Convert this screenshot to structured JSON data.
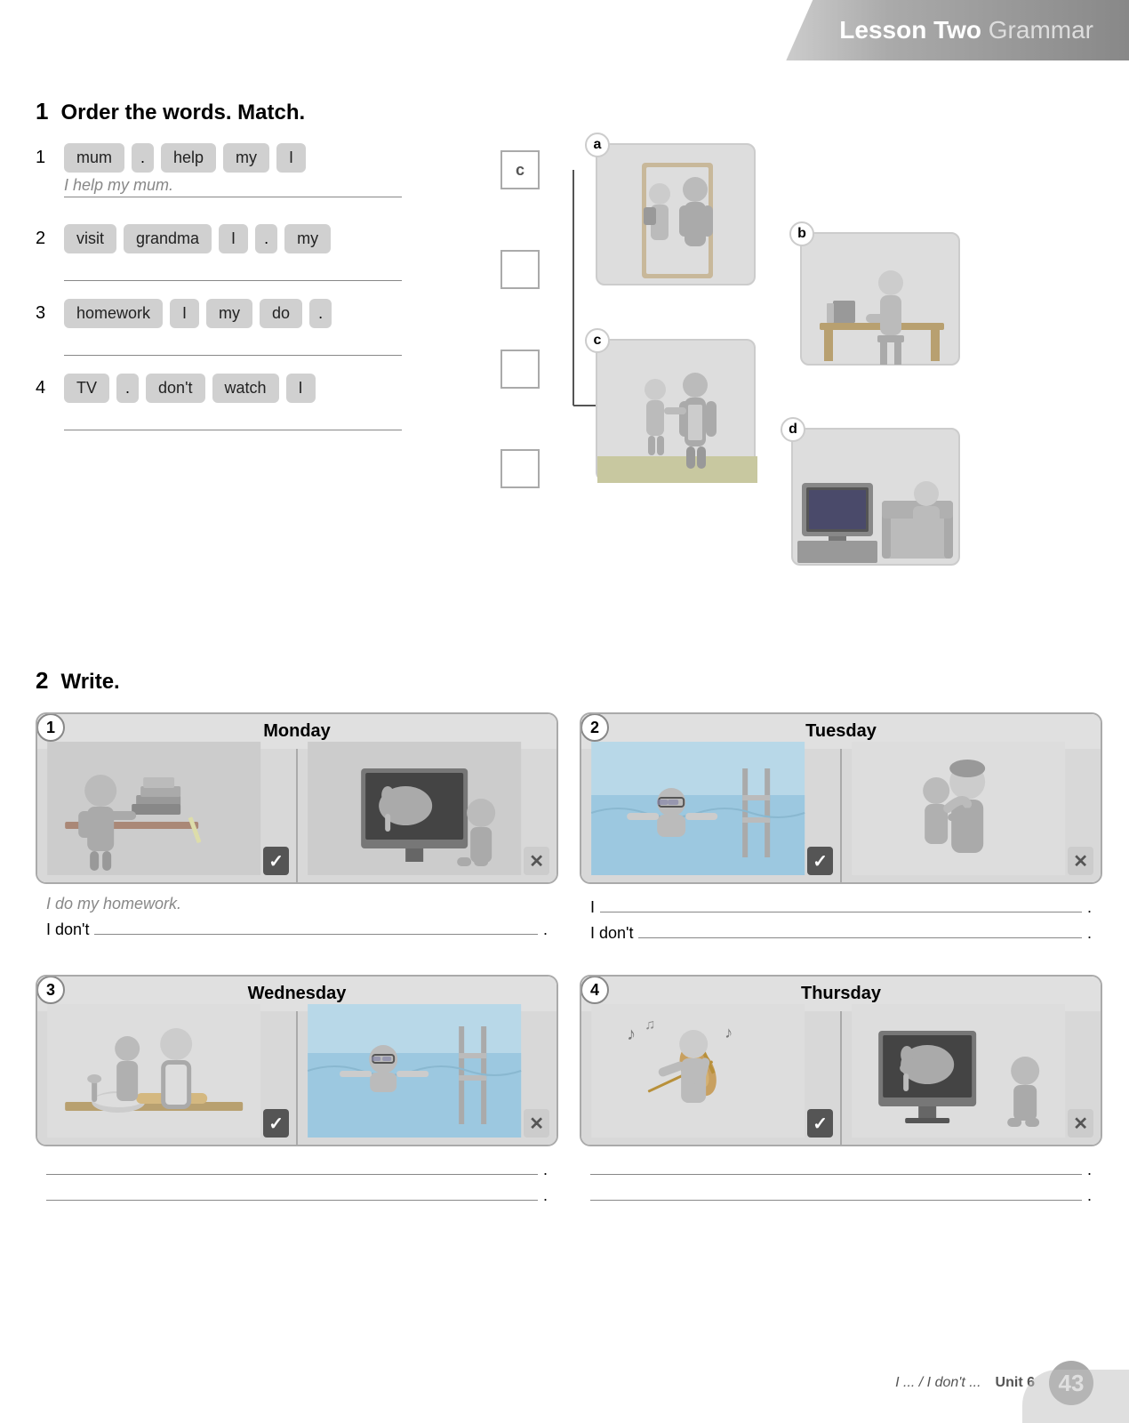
{
  "header": {
    "lesson_bold": "Lesson Two",
    "lesson_light": "Grammar"
  },
  "section1": {
    "number": "1",
    "heading": "Order the words. Match.",
    "rows": [
      {
        "num": "1",
        "chips": [
          "mum",
          ".",
          "help",
          "my",
          "I"
        ],
        "answer": "I help my mum.",
        "match_letter": "c"
      },
      {
        "num": "2",
        "chips": [
          "visit",
          "grandma",
          "I",
          ".",
          "my"
        ],
        "answer": "",
        "match_letter": ""
      },
      {
        "num": "3",
        "chips": [
          "homework",
          "I",
          "my",
          "do",
          "."
        ],
        "answer": "",
        "match_letter": ""
      },
      {
        "num": "4",
        "chips": [
          "TV",
          ".",
          "don't",
          "watch",
          "I"
        ],
        "answer": "",
        "match_letter": ""
      }
    ],
    "images": [
      {
        "label": "a",
        "description": "child helping at door with grandparent"
      },
      {
        "label": "b",
        "description": "child reading/studying at desk"
      },
      {
        "label": "c",
        "description": "child walking with adult outside"
      },
      {
        "label": "d",
        "description": "person watching TV on sofa"
      }
    ]
  },
  "section2": {
    "number": "2",
    "heading": "Write.",
    "cards": [
      {
        "number": "1",
        "day": "Monday",
        "img1_desc": "child doing homework at desk with books",
        "img2_desc": "child watching TV with elephant on screen",
        "img1_check": "check",
        "img2_check": "cross",
        "line1_prefix": "",
        "line1_text": "I do my homework.",
        "line1_italic": true,
        "line2_prefix": "I don't",
        "line2_blank": true
      },
      {
        "number": "2",
        "day": "Tuesday",
        "img1_desc": "child swimming in pool",
        "img2_desc": "child hugging grandparent",
        "img1_check": "check",
        "img2_check": "cross",
        "line1_prefix": "I",
        "line1_blank": true,
        "line2_prefix": "I don't",
        "line2_blank": true
      },
      {
        "number": "3",
        "day": "Wednesday",
        "img1_desc": "child cooking/baking with adult",
        "img2_desc": "child swimming with goggles",
        "img1_check": "check",
        "img2_check": "cross",
        "line1_blank_full": true,
        "line2_blank_full": true
      },
      {
        "number": "4",
        "day": "Thursday",
        "img1_desc": "child playing violin",
        "img2_desc": "child watching TV",
        "img1_check": "check",
        "img2_check": "cross",
        "line1_blank_full": true,
        "line2_blank_full": true
      }
    ]
  },
  "footer": {
    "left_text": "I ... / I don't ...",
    "unit_text": "Unit 6",
    "page_number": "43"
  }
}
